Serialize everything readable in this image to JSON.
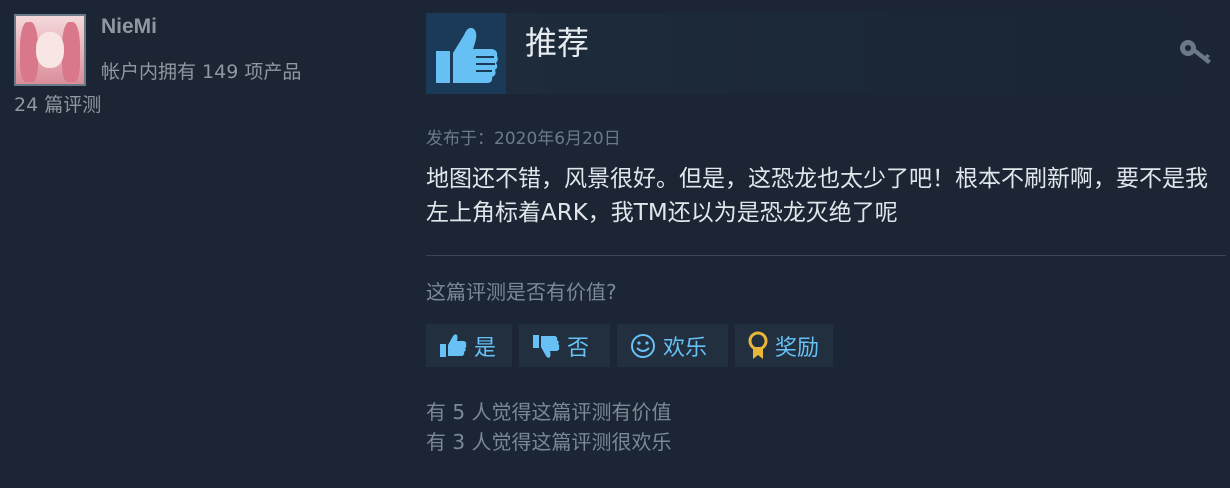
{
  "reviewer": {
    "name": "NieMi",
    "products_owned": "帐户内拥有 149 项产品",
    "review_count": "24 篇评测"
  },
  "review": {
    "verdict": "推荐",
    "posted_date": "发布于：2020年6月20日",
    "text": "地图还不错，风景很好。但是，这恐龙也太少了吧！根本不刷新啊，要不是我左上角标着ARK，我TM还以为是恐龙灭绝了呢"
  },
  "helpful_prompt": "这篇评测是否有价值?",
  "buttons": {
    "yes": "是",
    "no": "否",
    "funny": "欢乐",
    "award": "奖励"
  },
  "stats": {
    "helpful_count": "有 5 人觉得这篇评测有价值",
    "funny_count": "有 3 人觉得这篇评测很欢乐"
  },
  "icons": {
    "verdict": "thumbs-up-icon",
    "owner": "key-icon",
    "yes": "thumbs-up-icon",
    "no": "thumbs-down-icon",
    "funny": "smiley-icon",
    "award": "award-icon"
  },
  "colors": {
    "background": "#1b2533",
    "accent": "#67c1f5",
    "button_bg": "#212f3f",
    "thumb_box": "#1a3a57"
  }
}
